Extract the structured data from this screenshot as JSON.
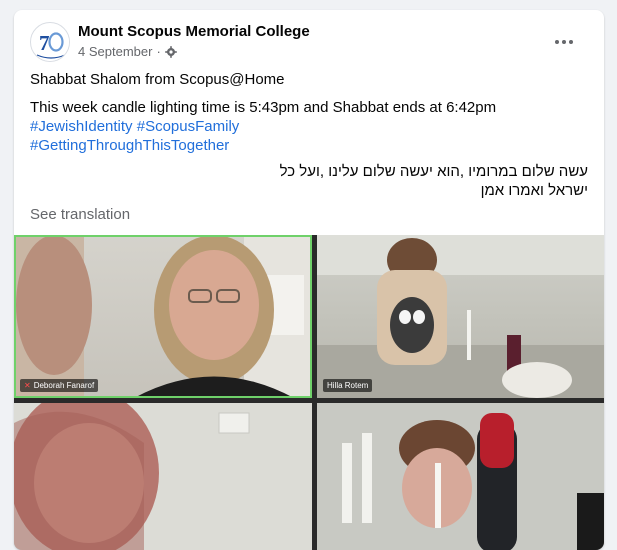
{
  "post": {
    "page_name": "Mount Scopus Memorial College",
    "date": "4 September",
    "dot": "·",
    "line1": "Shabbat Shalom from Scopus@Home",
    "line2": "This week candle lighting time is 5:43pm and Shabbat ends at 6:42pm",
    "hashtags": [
      "#JewishIdentity",
      "#ScopusFamily",
      "#GettingThroughThisTogether"
    ],
    "hebrew_line1": "עשה שלום במרומיו ,הוא יעשה שלום עלינו ,ועל כל",
    "hebrew_line2": "ישראל ואמרו אמן",
    "see_translation": "See translation"
  },
  "icons": {
    "privacy": "gear-icon",
    "more": "more-options-icon",
    "logo": "school-logo-70-icon"
  },
  "colors": {
    "link": "#216fdb",
    "speaker_highlight": "#6fd16a",
    "logo_blue": "#1f4fa0"
  },
  "video_call": {
    "participants": [
      {
        "name": "Deborah Fanarof",
        "muted": true,
        "speaking": true
      },
      {
        "name": "Hilla Rotem",
        "muted": false,
        "speaking": false
      },
      {
        "name": "",
        "muted": false,
        "speaking": false
      },
      {
        "name": "",
        "muted": false,
        "speaking": false
      }
    ]
  }
}
